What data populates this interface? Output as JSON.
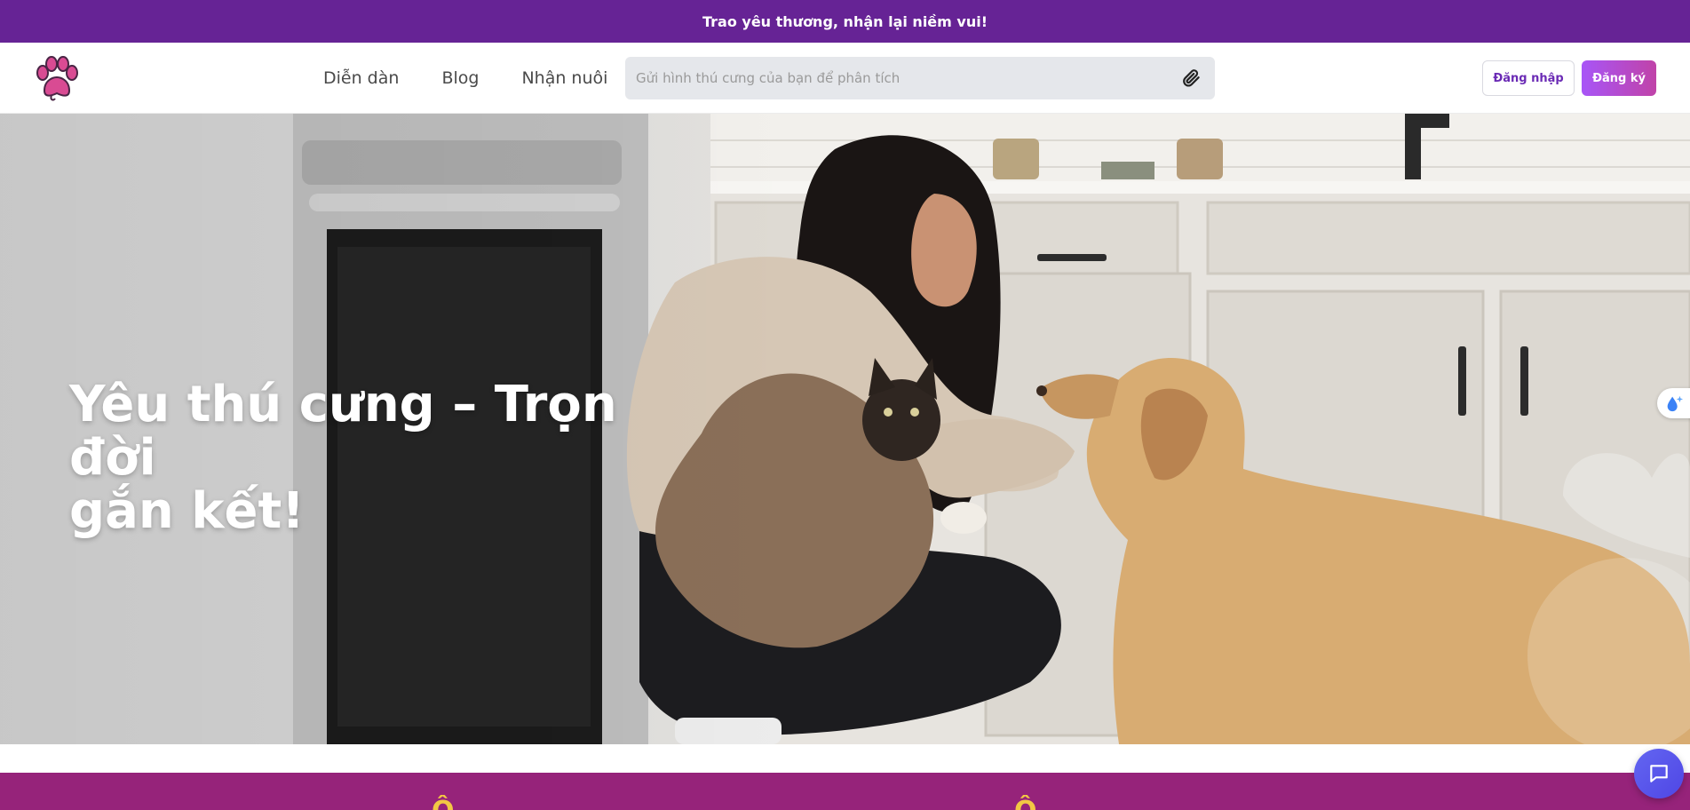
{
  "announcement": {
    "text": "Trao yêu thương, nhận lại niềm vui!"
  },
  "header": {
    "logo_icon": "paw-print-icon",
    "nav": [
      {
        "label": "Diễn dàn"
      },
      {
        "label": "Blog"
      },
      {
        "label": "Nhận nuôi"
      }
    ],
    "search": {
      "placeholder": "Gửi hình thú cưng của bạn để phân tích",
      "value": "",
      "icon": "paperclip-icon"
    },
    "login_label": "Đăng nhập",
    "signup_label": "Đăng ký"
  },
  "hero": {
    "title_line1": "Yêu thú cưng – Trọn đời",
    "title_line2": "gắn kết!",
    "image": "woman-with-cat-and-dog-in-kitchen"
  },
  "section_band": {
    "color": "#96237a",
    "text_color": "#f2c744",
    "left_fragment": "Ô",
    "right_fragment": "Ô"
  },
  "floating": {
    "side_widget_icon": "sparkle-drop-icon",
    "chat_icon": "chat-bubble-icon"
  },
  "colors": {
    "announcement_bg": "#662395",
    "primary": "#a855f7",
    "login_text": "#6b2bb5",
    "chat_button": "#4f46e5"
  }
}
